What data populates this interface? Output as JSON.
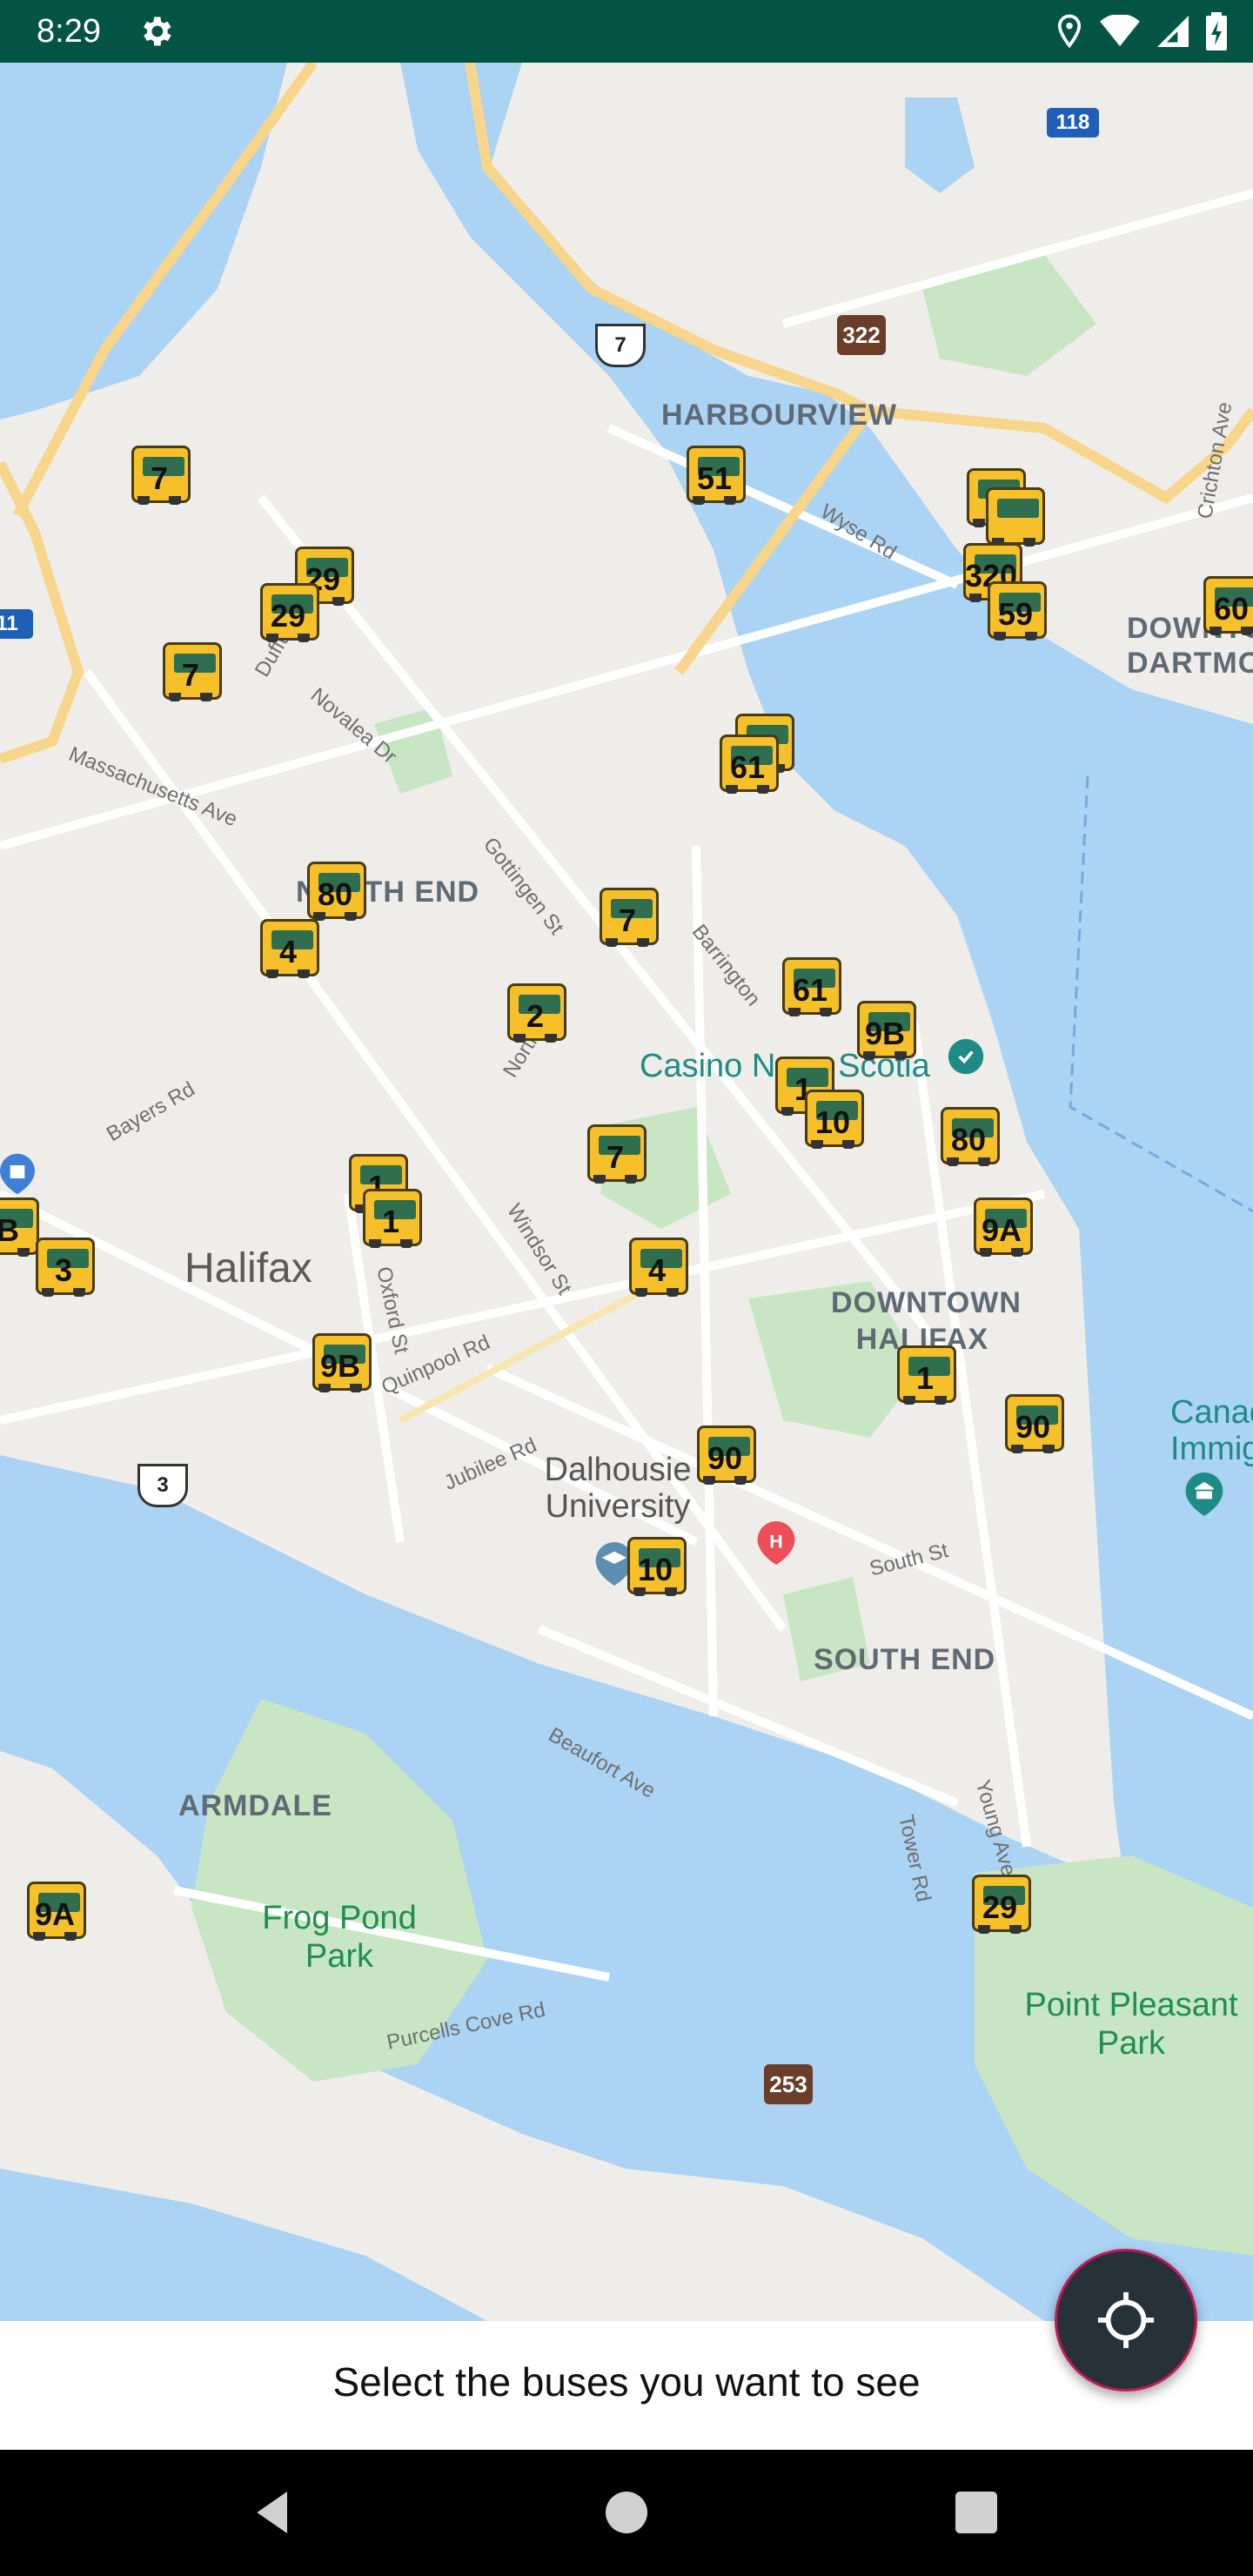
{
  "status_bar": {
    "time": "8:29",
    "icons": [
      "gear-icon",
      "location-icon",
      "wifi-icon",
      "signal-icon",
      "battery-icon"
    ]
  },
  "map": {
    "place_labels": {
      "harbourview": "HARBOURVIEW",
      "downtown_dartmouth": "DOWNTO DARTMO",
      "north_end": "NORTH END",
      "halifax": "Halifax",
      "downtown_halifax": "DOWNTOWN HALIFAX",
      "south_end": "SOUTH END",
      "armdale": "ARMDALE",
      "dalhousie": "Dalhousie University",
      "casino": "Casino Nova Scotia",
      "canadian_immig": "Canad Immig",
      "frog_pond": "Frog Pond Park",
      "point_pleasant": "Point Pleasant Park"
    },
    "street_labels": {
      "wyse": "Wyse Rd",
      "crichton": "Crichton Ave",
      "duffus": "Duffus",
      "novalea": "Novalea Dr",
      "massachusetts": "Massachusetts Ave",
      "gottingen": "Gottingen St",
      "barrington": "Barrington",
      "north": "North St",
      "bayers": "Bayers Rd",
      "windsor": "Windsor St",
      "oxford": "Oxford St",
      "quinpool": "Quinpool Rd",
      "jubilee": "Jubilee Rd",
      "south": "South St",
      "beaufort": "Beaufort Ave",
      "tower": "Tower Rd",
      "young": "Young Ave",
      "purcells": "Purcells Cove Rd"
    },
    "route_shields": {
      "s322": "322",
      "s253": "253",
      "h7": "7",
      "h3": "3",
      "b118": "118",
      "b11": "11"
    },
    "buses": [
      {
        "route": "7"
      },
      {
        "route": "51"
      },
      {
        "route": "29"
      },
      {
        "route": "29"
      },
      {
        "route": "7"
      },
      {
        "route": "320"
      },
      {
        "route": "59"
      },
      {
        "route": "60"
      },
      {
        "route": "61"
      },
      {
        "route": "80"
      },
      {
        "route": "4"
      },
      {
        "route": "7"
      },
      {
        "route": "61"
      },
      {
        "route": "9B"
      },
      {
        "route": "2"
      },
      {
        "route": "1"
      },
      {
        "route": "10"
      },
      {
        "route": "80"
      },
      {
        "route": "7"
      },
      {
        "route": "1"
      },
      {
        "route": "1"
      },
      {
        "route": "9A"
      },
      {
        "route": "B"
      },
      {
        "route": "3"
      },
      {
        "route": "4"
      },
      {
        "route": "9B"
      },
      {
        "route": "1"
      },
      {
        "route": "90"
      },
      {
        "route": "90"
      },
      {
        "route": "10"
      },
      {
        "route": "9A"
      },
      {
        "route": "29"
      }
    ]
  },
  "bottom_panel": {
    "prompt": "Select the buses you want to see"
  },
  "fab": {
    "icon": "my-location-icon"
  },
  "nav_bar": {
    "icons": [
      "back-icon",
      "home-icon",
      "recents-icon"
    ]
  }
}
